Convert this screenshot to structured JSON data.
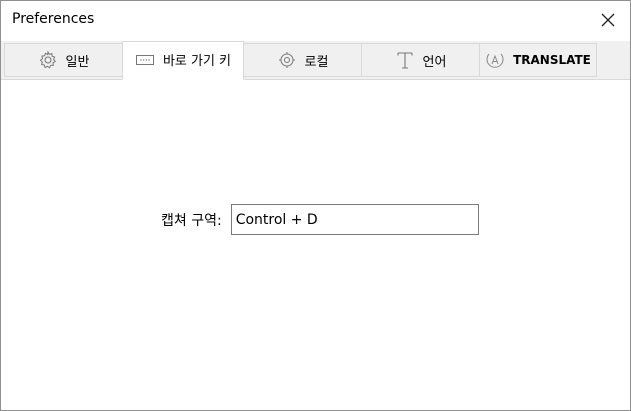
{
  "window": {
    "title": "Preferences"
  },
  "tabs": [
    {
      "label": "일반",
      "icon": "gear-icon",
      "active": false
    },
    {
      "label": "바로 가기 키",
      "icon": "keyboard-icon",
      "active": true
    },
    {
      "label": "로컬",
      "icon": "target-gear-icon",
      "active": false
    },
    {
      "label": "언어",
      "icon": "text-t-icon",
      "active": false
    },
    {
      "label": "TRANSLATE",
      "icon": "translate-a-icon",
      "active": false
    }
  ],
  "shortcut": {
    "label": "캡쳐 구역:",
    "value": "Control + D"
  }
}
